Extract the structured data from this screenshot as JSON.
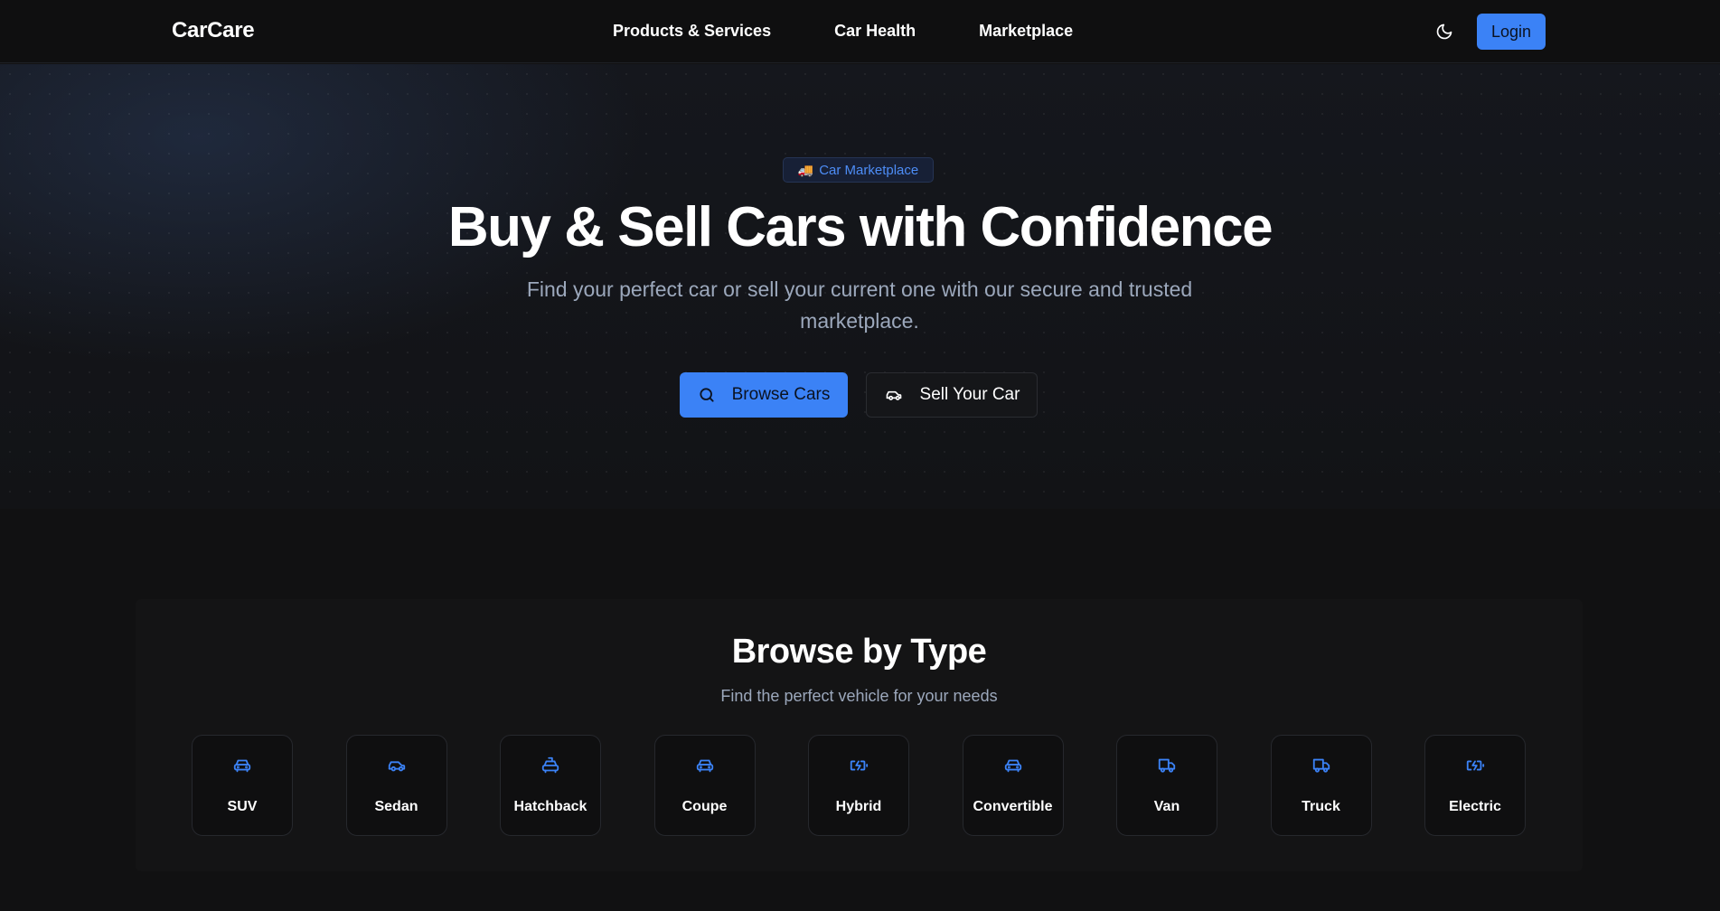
{
  "colors": {
    "accent": "#3b82f6",
    "background": "#111112",
    "muted_text": "#9ca8bc"
  },
  "header": {
    "brand": "CarCare",
    "nav": [
      "Products & Services",
      "Car Health",
      "Marketplace"
    ],
    "theme_icon": "moon-icon",
    "login_label": "Login"
  },
  "hero": {
    "badge_icon": "truck-emoji",
    "badge_label": "Car Marketplace",
    "title": "Buy & Sell Cars with Confidence",
    "subtitle": "Find your perfect car or sell your current one with our secure and trusted marketplace.",
    "browse_icon": "search-icon",
    "browse_label": "Browse Cars",
    "sell_icon": "car-icon",
    "sell_label": "Sell Your Car"
  },
  "types": {
    "title": "Browse by Type",
    "subtitle": "Find the perfect vehicle for your needs",
    "items": [
      {
        "label": "SUV",
        "icon": "car-front-icon"
      },
      {
        "label": "Sedan",
        "icon": "car-icon"
      },
      {
        "label": "Hatchback",
        "icon": "car-taxi-icon"
      },
      {
        "label": "Coupe",
        "icon": "car-front-icon"
      },
      {
        "label": "Hybrid",
        "icon": "battery-charging-icon"
      },
      {
        "label": "Convertible",
        "icon": "car-front-icon"
      },
      {
        "label": "Van",
        "icon": "truck-icon"
      },
      {
        "label": "Truck",
        "icon": "truck-icon"
      },
      {
        "label": "Electric",
        "icon": "battery-charging-icon"
      }
    ]
  }
}
